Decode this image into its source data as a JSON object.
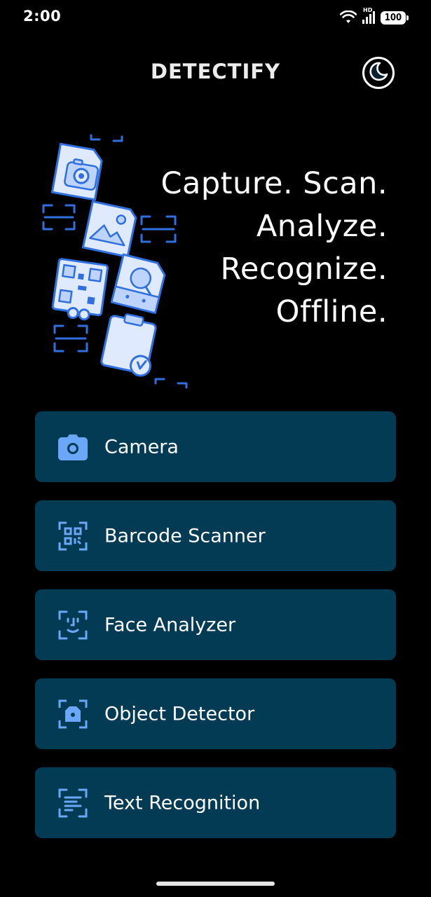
{
  "status_bar": {
    "time": "2:00",
    "network_badge": "HD",
    "battery": "100"
  },
  "app": {
    "title": "DETECTIFY",
    "theme_icon": "moon-icon"
  },
  "hero": {
    "lines": [
      "Capture. Scan.",
      "Analyze.",
      "Recognize.",
      "Offline."
    ],
    "illustration_icons": [
      "photo-document-icon",
      "image-document-icon",
      "qr-code-document-icon",
      "search-document-icon",
      "clipboard-document-icon",
      "scan-frame-icon"
    ]
  },
  "menu": {
    "items": [
      {
        "label": "Camera",
        "icon": "camera-icon"
      },
      {
        "label": "Barcode Scanner",
        "icon": "qr-scan-icon"
      },
      {
        "label": "Face Analyzer",
        "icon": "face-scan-icon"
      },
      {
        "label": "Object Detector",
        "icon": "object-scan-icon"
      },
      {
        "label": "Text Recognition",
        "icon": "text-scan-icon"
      }
    ]
  },
  "colors": {
    "background": "#000000",
    "card": "#033b55",
    "icon_accent": "#5aa2f5",
    "illustration_stroke": "#2f6fe0",
    "illustration_fill": "#dfeaff"
  }
}
